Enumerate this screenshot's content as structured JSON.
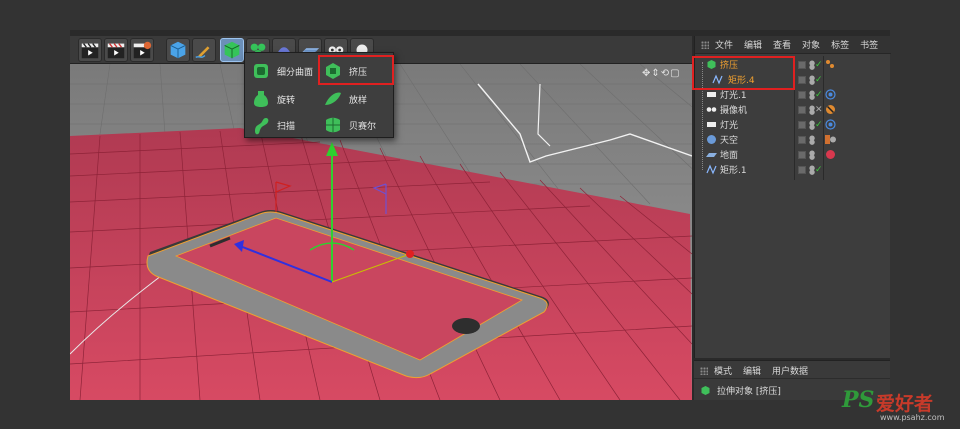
{
  "toolbar": {
    "buttons": [
      "clapper-render-icon",
      "clapper-picture-viewer-icon",
      "clapper-render-settings-icon",
      "cube-icon",
      "pen-spline-icon",
      "generator-nurbs-icon",
      "array-icon",
      "deformer-icon",
      "floor-icon",
      "camera-icon",
      "light-icon"
    ]
  },
  "menu": {
    "items": [
      {
        "label": "细分曲面",
        "icon": "subdivision-surface-icon"
      },
      {
        "label": "挤压",
        "icon": "extrude-icon",
        "highlighted": true
      },
      {
        "label": "旋转",
        "icon": "lathe-icon"
      },
      {
        "label": "放样",
        "icon": "loft-icon"
      },
      {
        "label": "扫描",
        "icon": "sweep-icon"
      },
      {
        "label": "贝赛尔",
        "icon": "bezier-icon"
      }
    ]
  },
  "object_manager": {
    "menu": [
      "文件",
      "编辑",
      "查看",
      "对象",
      "标签",
      "书签"
    ],
    "objects": [
      {
        "label": "挤压",
        "icon": "extrude-icon",
        "selected": true,
        "color": "#f0a030"
      },
      {
        "label": "矩形.4",
        "icon": "spline-icon",
        "selected": true,
        "color": "#f0a030"
      },
      {
        "label": "灯光.1",
        "icon": "light-icon",
        "tag": "target-tag-icon"
      },
      {
        "label": "摄像机",
        "icon": "camera-icon",
        "tag": "protect-tag-icon"
      },
      {
        "label": "灯光",
        "icon": "light-icon",
        "tag": "target-tag-icon"
      },
      {
        "label": "天空",
        "icon": "sky-icon",
        "tag": "material-tag-icon"
      },
      {
        "label": "地面",
        "icon": "floor-icon",
        "tag": "material-sphere-tag-icon"
      },
      {
        "label": "矩形.1",
        "icon": "spline-icon"
      }
    ]
  },
  "attribute_manager": {
    "menu": [
      "模式",
      "编辑",
      "用户数据"
    ],
    "title": "拉伸对象 [挤压]"
  },
  "viewport": {
    "nav_icons": "✥⇕⟲▢"
  },
  "watermark": {
    "logo": "PS",
    "logo_cn": "爱好者",
    "url": "www.psahz.com"
  },
  "colors": {
    "floor": "#d04860",
    "grid_background": "#8a8a8a",
    "selection_orange": "#f0a030",
    "highlight_red": "#e02020",
    "axis_green": "#2fd02f",
    "axis_blue": "#3030e0"
  }
}
